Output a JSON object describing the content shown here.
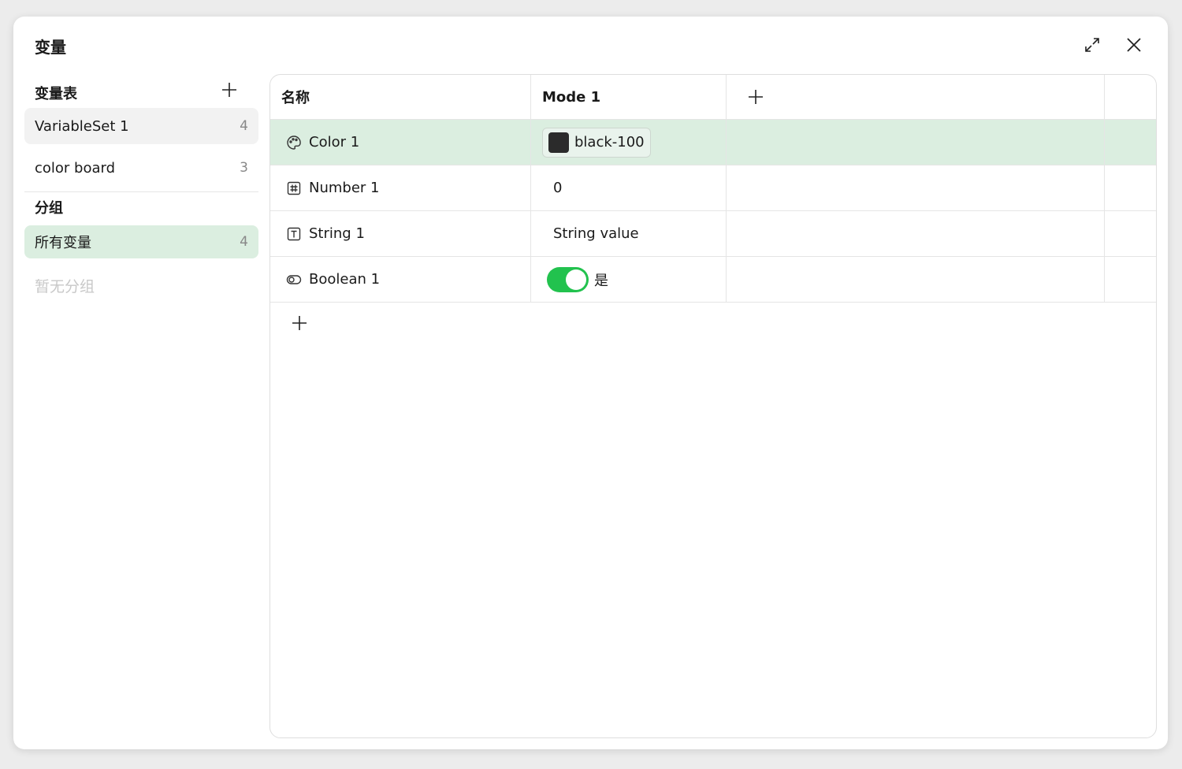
{
  "dialog": {
    "title": "变量",
    "expand_icon": "expand-icon",
    "close_icon": "close-icon"
  },
  "sidebar": {
    "sets_title": "变量表",
    "sets": [
      {
        "name": "VariableSet 1",
        "count": "4"
      },
      {
        "name": "color board",
        "count": "3"
      }
    ],
    "groups_title": "分组",
    "groups": [
      {
        "name": "所有变量",
        "count": "4"
      }
    ],
    "empty_groups_text": "暂无分组"
  },
  "table": {
    "headers": {
      "name": "名称",
      "mode": "Mode 1"
    },
    "rows": [
      {
        "type": "color",
        "icon": "palette-icon",
        "name": "Color 1",
        "value": "black-100",
        "swatch_color": "#2b2b2b"
      },
      {
        "type": "number",
        "icon": "hash-icon",
        "name": "Number 1",
        "value": "0"
      },
      {
        "type": "string",
        "icon": "text-icon",
        "name": "String 1",
        "value": "String value"
      },
      {
        "type": "boolean",
        "icon": "toggle-icon",
        "name": "Boolean 1",
        "value": "是",
        "checked": true
      }
    ]
  },
  "colors": {
    "accent_green": "#22c24e",
    "selected_row": "#dbeee0",
    "active_item_bg": "#f2f2f2"
  }
}
